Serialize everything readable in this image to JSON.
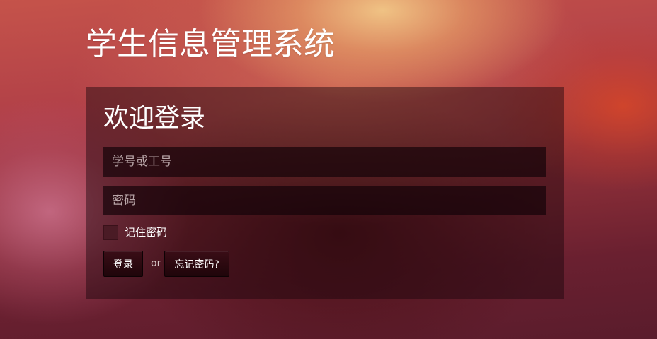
{
  "app": {
    "title": "学生信息管理系统"
  },
  "login": {
    "heading": "欢迎登录",
    "username_placeholder": "学号或工号",
    "username_value": "",
    "password_placeholder": "密码",
    "password_value": "",
    "remember_label": "记住密码",
    "remember_checked": false,
    "login_button": "登录",
    "or_text": "or",
    "forgot_button": "忘记密码?"
  }
}
